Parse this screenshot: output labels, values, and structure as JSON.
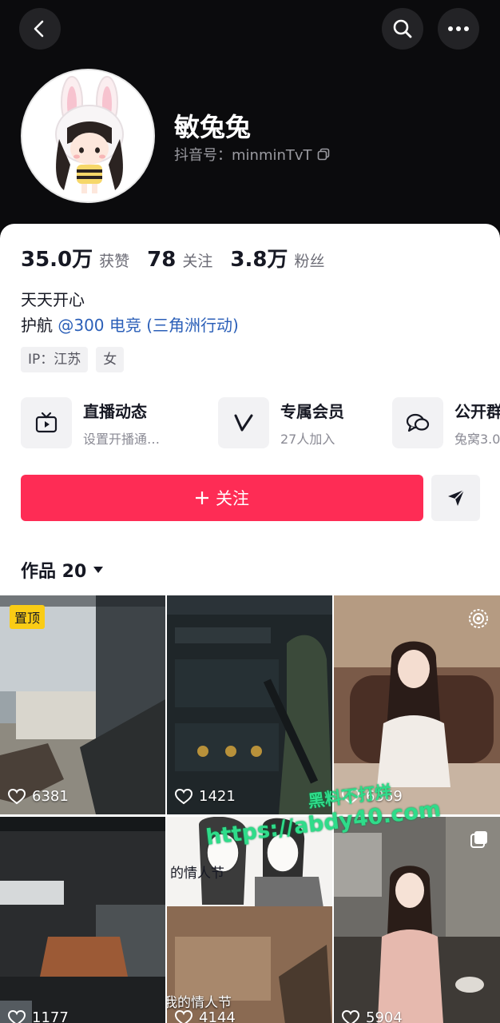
{
  "profile": {
    "nickname": "敏兔兔",
    "douyin_id": "抖音号：minminTvT"
  },
  "stats": [
    {
      "value": "35.0万",
      "label": "获赞"
    },
    {
      "value": "78",
      "label": "关注"
    },
    {
      "value": "3.8万",
      "label": "粉丝"
    }
  ],
  "bio": {
    "line1": "天天开心",
    "guard_prefix": "护航 ",
    "guard_link": "@300 电竞 (三角洲行动)"
  },
  "tags": [
    "IP：江苏",
    "女"
  ],
  "features": [
    {
      "title": "直播动态",
      "subtitle": "设置开播通…",
      "icon": "tv-icon"
    },
    {
      "title": "专属会员",
      "subtitle": "27人加入",
      "icon": "v-icon"
    },
    {
      "title": "公开群",
      "subtitle": "兔窝3.0",
      "icon": "chat-icon"
    }
  ],
  "actions": {
    "follow_label": "关注"
  },
  "works": {
    "label": "作品 20"
  },
  "videos": [
    {
      "likes": "6381",
      "pinned_label": "置顶"
    },
    {
      "likes": "1421"
    },
    {
      "likes": "6369"
    },
    {
      "likes": "1177"
    },
    {
      "likes": "4144"
    },
    {
      "likes": "5904"
    }
  ],
  "video_texts": {
    "valentine_top": "的情人节",
    "valentine_bottom": "我的情人节"
  },
  "watermark": {
    "line1": "黑料不打烊",
    "line2": "https://abdy40.com"
  },
  "colors": {
    "accent": "#fe2c55",
    "link": "#2b5fb8",
    "pin": "#facc15",
    "watermark": "#2fdc8a"
  }
}
